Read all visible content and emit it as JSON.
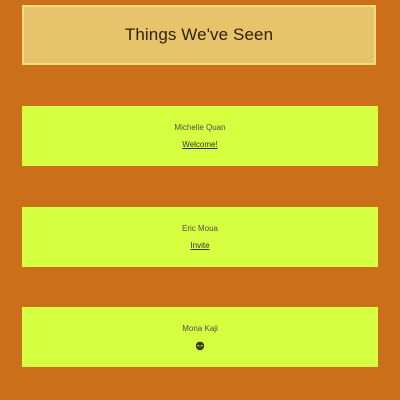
{
  "header": {
    "title": "Things We've Seen"
  },
  "cards": [
    {
      "name": "Michelle Quan",
      "link": "Welcome!"
    },
    {
      "name": "Eric Moua",
      "link": "Invite"
    },
    {
      "name": "Mona Kaji",
      "icon": "alien-face-icon"
    }
  ],
  "colors": {
    "page_background": "#cc6f1b",
    "header_background": "#e7c36c",
    "card_background": "#d5ff3f"
  }
}
